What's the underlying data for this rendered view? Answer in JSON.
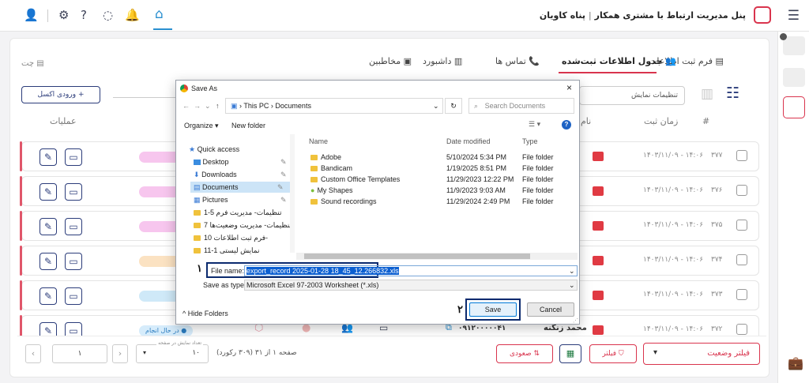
{
  "header": {
    "title": "پنل مدیریت ارتباط با مشتری همکار",
    "separator": "|",
    "org": "پناه کاویان"
  },
  "chat_label": "چت",
  "tabs": [
    {
      "label": "فرم ثبت اطلاعات"
    },
    {
      "label": "جدول اطلاعات ثبت‌شده"
    },
    {
      "label": "تماس ها"
    },
    {
      "label": "داشبورد"
    },
    {
      "label": "مخاطبین"
    }
  ],
  "toolbar": {
    "excel_import": "+ ورودی اکسل",
    "display_settings": "تنظیمات نمایش"
  },
  "table": {
    "col_ops": "عملیات",
    "col_time": "زمان ثبت",
    "col_hash": "#",
    "col_name_partial": "نام",
    "rows": [
      {
        "time": "۱۴۰۳/۱۱/۰۹ - ۱۴:۰۶",
        "num": "۳۷۷"
      },
      {
        "time": "۱۴۰۳/۱۱/۰۹ - ۱۴:۰۶",
        "num": "۳۷۶"
      },
      {
        "time": "۱۴۰۳/۱۱/۰۹ - ۱۴:۰۶",
        "num": "۳۷۵"
      },
      {
        "time": "۱۴۰۳/۱۱/۰۹ - ۱۴:۰۶",
        "num": "۳۷۴"
      },
      {
        "time": "۱۴۰۳/۱۱/۰۹ - ۱۴:۰۶",
        "num": "۳۷۳"
      },
      {
        "time": "۱۴۰۳/۱۱/۰۹ - ۱۴:۰۶",
        "num": "۳۷۲",
        "name": "محمد زنگنه",
        "phone": "۰۹۱۲۰۰۰۰۰۴۱",
        "status": "در حال انجام"
      }
    ]
  },
  "footer": {
    "status_filter": "فیلتر وضعیت",
    "filter": "فیلتر",
    "sort": "صعودی",
    "pagination_text": "صفحه ۱ از ۳۱ (۳۰۹ رکورد)",
    "page_size_label": "تعداد نمایش در صفحه",
    "page_size": "۱۰",
    "page": "۱"
  },
  "dialog": {
    "title": "Save As",
    "close": "×",
    "breadcrumb": [
      "This PC",
      "Documents"
    ],
    "search_placeholder": "Search Documents",
    "organize": "Organize",
    "new_folder": "New folder",
    "columns": {
      "name": "Name",
      "date": "Date modified",
      "type": "Type"
    },
    "nav": [
      "Quick access",
      "Desktop",
      "Downloads",
      "Documents",
      "Pictures",
      "تنظیمات- مدیریت فرم 5-1",
      "تنظیمات- مدیریت وضعیت‌ها 7-",
      "فرم ثبت اطلاعات 10-",
      "نمایش لیستی 1-11"
    ],
    "files": [
      {
        "name": "Adobe",
        "date": "5/10/2024 5:34 PM",
        "type": "File folder"
      },
      {
        "name": "Bandicam",
        "date": "1/19/2025 8:51 PM",
        "type": "File folder"
      },
      {
        "name": "Custom Office Templates",
        "date": "11/29/2023 12:22 PM",
        "type": "File folder"
      },
      {
        "name": "My Shapes",
        "date": "11/9/2023 9:03 AM",
        "type": "File folder"
      },
      {
        "name": "Sound recordings",
        "date": "11/29/2024 2:49 PM",
        "type": "File folder"
      }
    ],
    "filename_label": "File name:",
    "filename_value": "export_record 2025-01-28 18_45_12.266832.xls",
    "savetype_label": "Save as type:",
    "savetype_value": "Microsoft Excel 97-2003 Worksheet (*.xls)",
    "hide_folders": "Hide Folders",
    "save": "Save",
    "cancel": "Cancel",
    "marker_1": "۱",
    "marker_2": "۲"
  },
  "colors": {
    "accent": "#d9344d",
    "navy": "#2b3c7a",
    "highlight": "#0b2a6e"
  }
}
